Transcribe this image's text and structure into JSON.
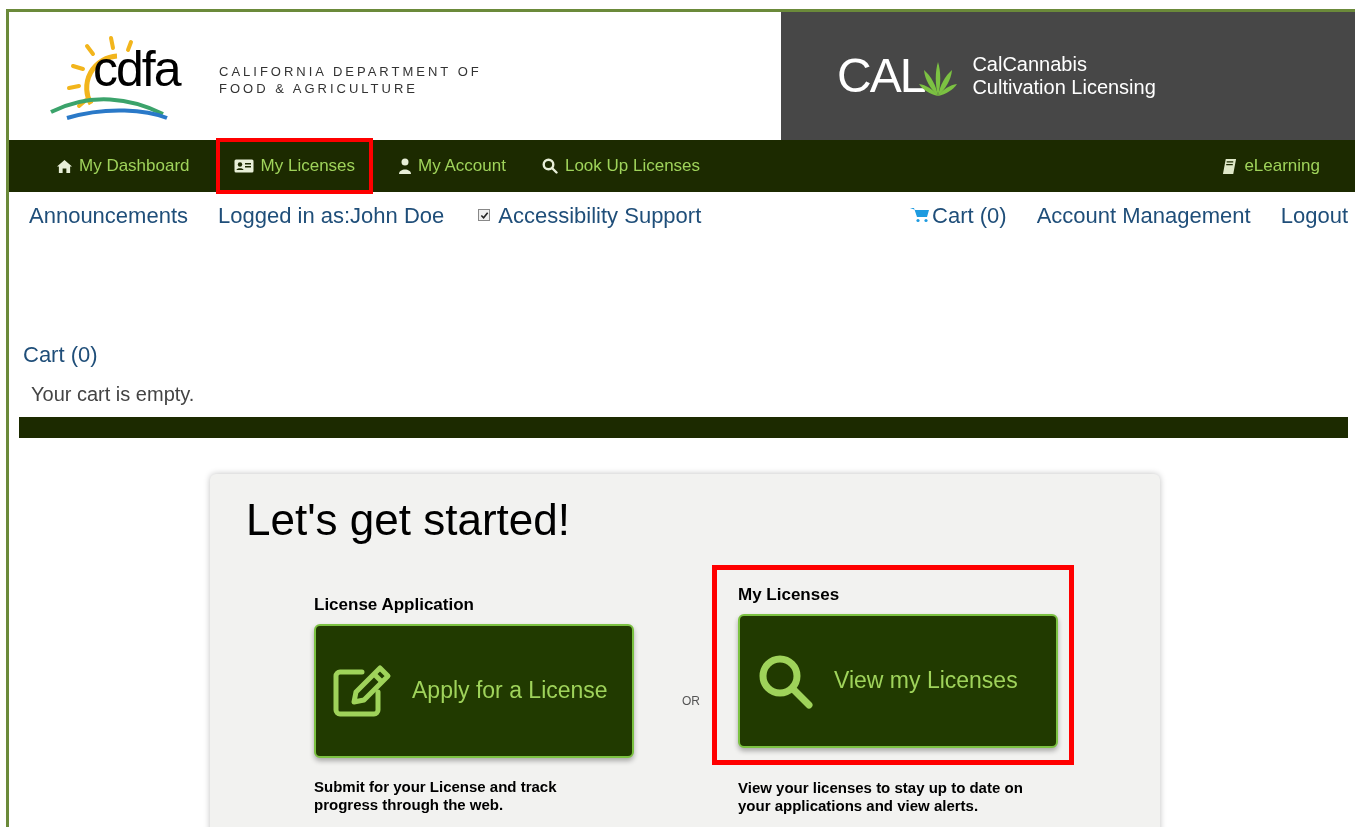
{
  "header": {
    "agency_logo": {
      "mark": "cdfa",
      "name_lines": [
        "CALIFORNIA DEPARTMENT OF",
        "FOOD & AGRICULTURE"
      ]
    },
    "program_logo": {
      "mark": "CAL",
      "name_lines": [
        "CalCannabis",
        "Cultivation Licensing"
      ]
    }
  },
  "nav": {
    "items": [
      {
        "label": "My Dashboard",
        "highlighted": false
      },
      {
        "label": "My Licenses",
        "highlighted": true
      },
      {
        "label": "My Account",
        "highlighted": false
      },
      {
        "label": "Look Up Licenses",
        "highlighted": false
      }
    ],
    "right_items": [
      {
        "label": "eLearning",
        "highlighted": false
      }
    ]
  },
  "utility_links": [
    {
      "kind": "link",
      "label": "Announcements"
    },
    {
      "kind": "text",
      "label": "Logged in as:John Doe"
    },
    {
      "kind": "checkbox",
      "label": "Accessibility Support",
      "checked": true
    },
    {
      "kind": "cart",
      "label": "Cart (0)"
    },
    {
      "kind": "link",
      "label": "Account Management"
    },
    {
      "kind": "link",
      "label": "Logout"
    }
  ],
  "cart": {
    "title": "Cart (0)",
    "message": "Your cart is empty."
  },
  "get_started": {
    "title": "Let's get started!",
    "separator": "OR",
    "options": [
      {
        "heading": "License Application",
        "button": "Apply for a License",
        "description": "Submit for your License and track progress through the web.",
        "highlighted": false
      },
      {
        "heading": "My Licenses",
        "button": "View my Licenses",
        "description": "View your licenses to stay up to date on your applications and view alerts.",
        "highlighted": true
      }
    ]
  }
}
